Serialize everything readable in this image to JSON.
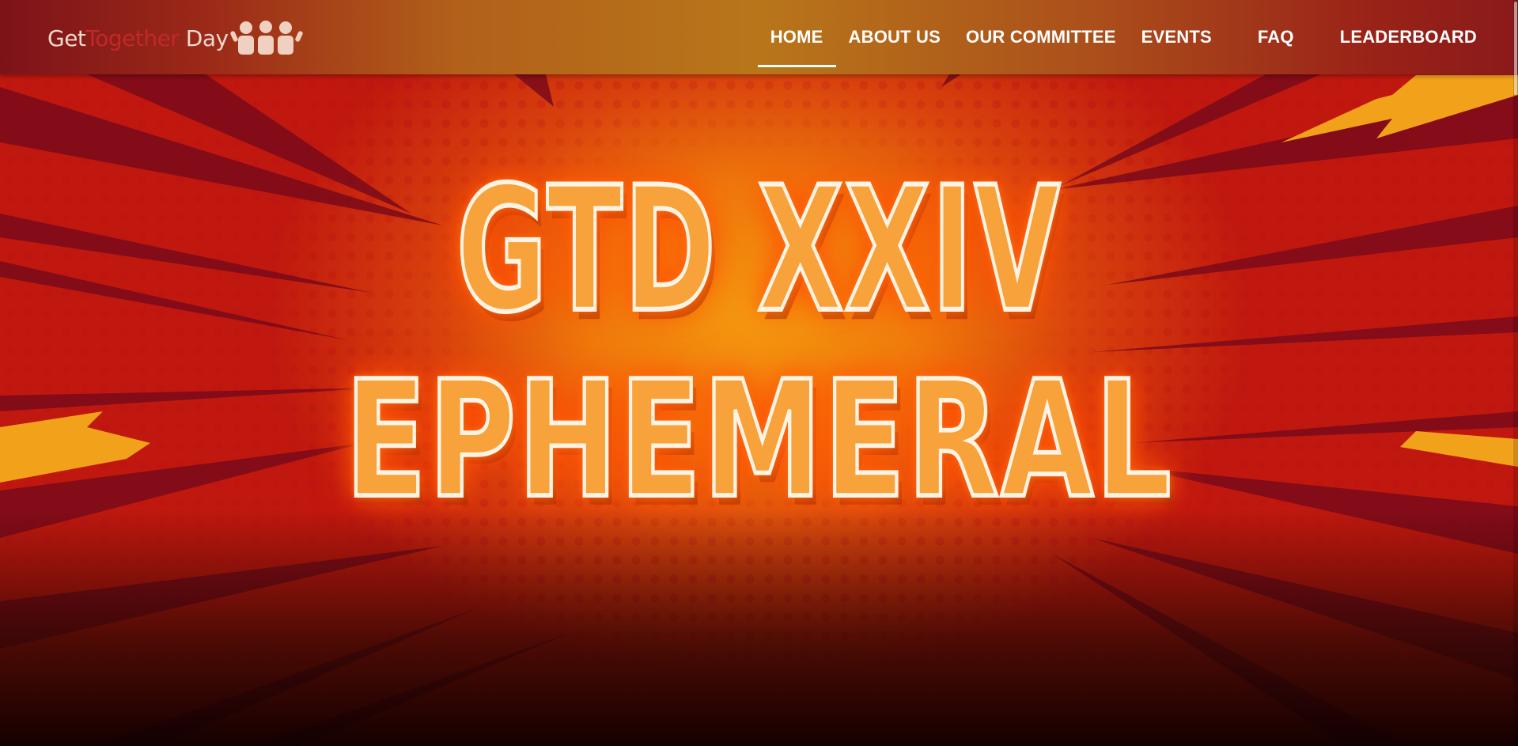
{
  "logo": {
    "part_get": "Get",
    "part_together": "Together",
    "part_day": "Day",
    "icon": "people-group-icon"
  },
  "nav": {
    "items": [
      {
        "label": "HOME",
        "active": true
      },
      {
        "label": "ABOUT US",
        "active": false
      },
      {
        "label": "OUR COMMITTEE",
        "active": false
      },
      {
        "label": "EVENTS",
        "active": false
      },
      {
        "label": "FAQ",
        "active": false
      },
      {
        "label": "LEADERBOARD",
        "active": false
      }
    ]
  },
  "hero": {
    "title_line1": "GTD XXIV",
    "title_line2": "EPHEMERAL",
    "skull_icon": "skull-face-icon"
  },
  "colors": {
    "accent_orange": "#f59b10",
    "hero_red": "#c0180e",
    "nav_white": "#ffffff",
    "logo_red": "#c0282a"
  }
}
